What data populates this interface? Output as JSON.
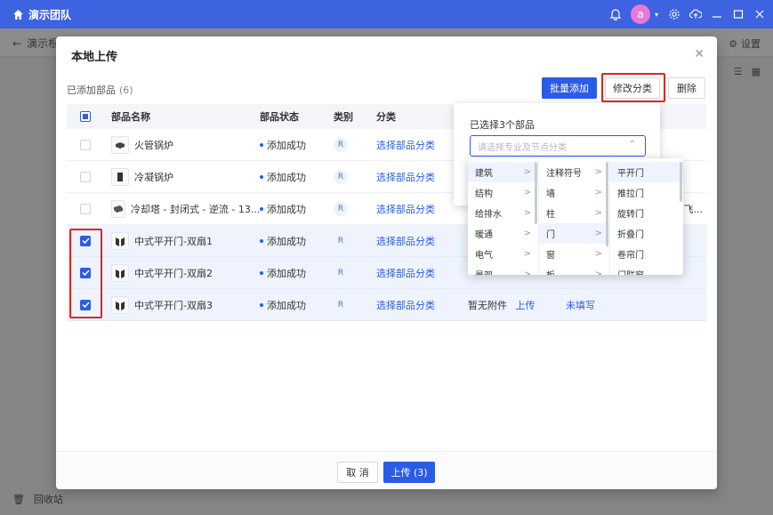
{
  "app": {
    "team_name": "演示团队",
    "avatar_letter": "a"
  },
  "background": {
    "back_label": "演示根",
    "settings_label": "设置",
    "recycle_label": "回收站"
  },
  "modal": {
    "title": "本地上传",
    "added_label": "已添加部品",
    "added_count": "(6)",
    "batch_add": "批量添加",
    "modify_category": "修改分类",
    "delete": "删除",
    "cancel": "取 消",
    "upload": "上传 (3)"
  },
  "table": {
    "headers": {
      "name": "部品名称",
      "status": "部品状态",
      "type": "类别",
      "category": "分类"
    },
    "rows": [
      {
        "name": "火管锅炉",
        "status": "添加成功",
        "type": "R",
        "category": "选择部品分类",
        "attachment": "",
        "attachment_link": "",
        "desc": "",
        "checked": false
      },
      {
        "name": "冷凝锅炉",
        "status": "添加成功",
        "type": "R",
        "category": "选择部品分类",
        "attachment": "",
        "attachment_link": "",
        "desc": "",
        "checked": false
      },
      {
        "name": "冷却塔 - 封闭式 - 逆流 - 13...",
        "status": "添加成功",
        "type": "R",
        "category": "选择部品分类",
        "attachment": "",
        "attachment_link": "",
        "desc": "飞...",
        "checked": false
      },
      {
        "name": "中式平开门-双扇1",
        "status": "添加成功",
        "type": "R",
        "category": "选择部品分类",
        "attachment": "",
        "attachment_link": "",
        "desc": "",
        "checked": true
      },
      {
        "name": "中式平开门-双扇2",
        "status": "添加成功",
        "type": "R",
        "category": "选择部品分类",
        "attachment": "",
        "attachment_link": "",
        "desc": "",
        "checked": true
      },
      {
        "name": "中式平开门-双扇3",
        "status": "添加成功",
        "type": "R",
        "category": "选择部品分类",
        "attachment": "暂无附件",
        "attachment_link": "上传",
        "desc": "未填写",
        "checked": true
      }
    ]
  },
  "popover": {
    "title": "已选择3个部品",
    "placeholder": "请选择专业及节点分类",
    "col1": [
      "建筑",
      "结构",
      "给排水",
      "暖通",
      "电气",
      "景观"
    ],
    "col2": [
      "注释符号",
      "墙",
      "柱",
      "门",
      "窗",
      "板"
    ],
    "col3": [
      "平开门",
      "推拉门",
      "旋转门",
      "折叠门",
      "卷帘门",
      "门联窗"
    ]
  },
  "colors": {
    "primary": "#2b5ce6",
    "titlebar": "#3d63e0",
    "highlight": "#e0261b"
  }
}
